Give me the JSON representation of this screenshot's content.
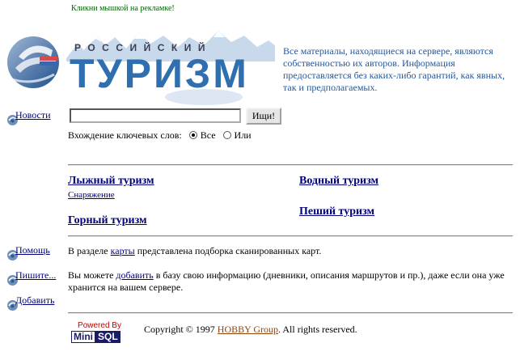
{
  "ad_note": "Кликни мышкой на рекламке!",
  "logo": {
    "subtitle": "РОССИЙСКИЙ",
    "title": "ТУРИЗМ"
  },
  "disclaimer": "Все материалы, находящиеся на сервере, являются собственностью их авторов. Информация предоставляется без каких-либо гарантий, как явных, так и предполагаемых.",
  "nav": {
    "news": "Новости",
    "help": "Помощь",
    "write": "Пишите...",
    "add": "Добавить"
  },
  "search": {
    "value": "",
    "button": "Ищи!",
    "keywords_label": "Вхождение ключевых слов:",
    "option_all": "Все",
    "option_any": "Или",
    "selected": "Все"
  },
  "categories": {
    "ski": "Лыжный туризм",
    "equipment": "Снаряжение",
    "mountain": "Горный туризм",
    "water": "Водный туризм",
    "hiking": "Пеший туризм"
  },
  "info": {
    "maps_pre": "В разделе ",
    "maps_link": "карты",
    "maps_post": " представлена подборка сканированных карт.",
    "add_pre": "Вы можете ",
    "add_link": "добавить",
    "add_post": " в базу свою информацию (дневники, описания маршрутов и пр.), даже если она уже хранится на вашем сервере."
  },
  "footer": {
    "powered_by": "Powered By",
    "mini": "Mini",
    "sql": "SQL",
    "copyright_pre": "Copyright © 1997 ",
    "copyright_link": "HOBBY Group",
    "copyright_post": ". All rights reserved."
  },
  "colors": {
    "link": "#00007a",
    "logo_blue": "#2f6fb0",
    "disclaimer": "#24579a",
    "ad_green": "#006400"
  }
}
